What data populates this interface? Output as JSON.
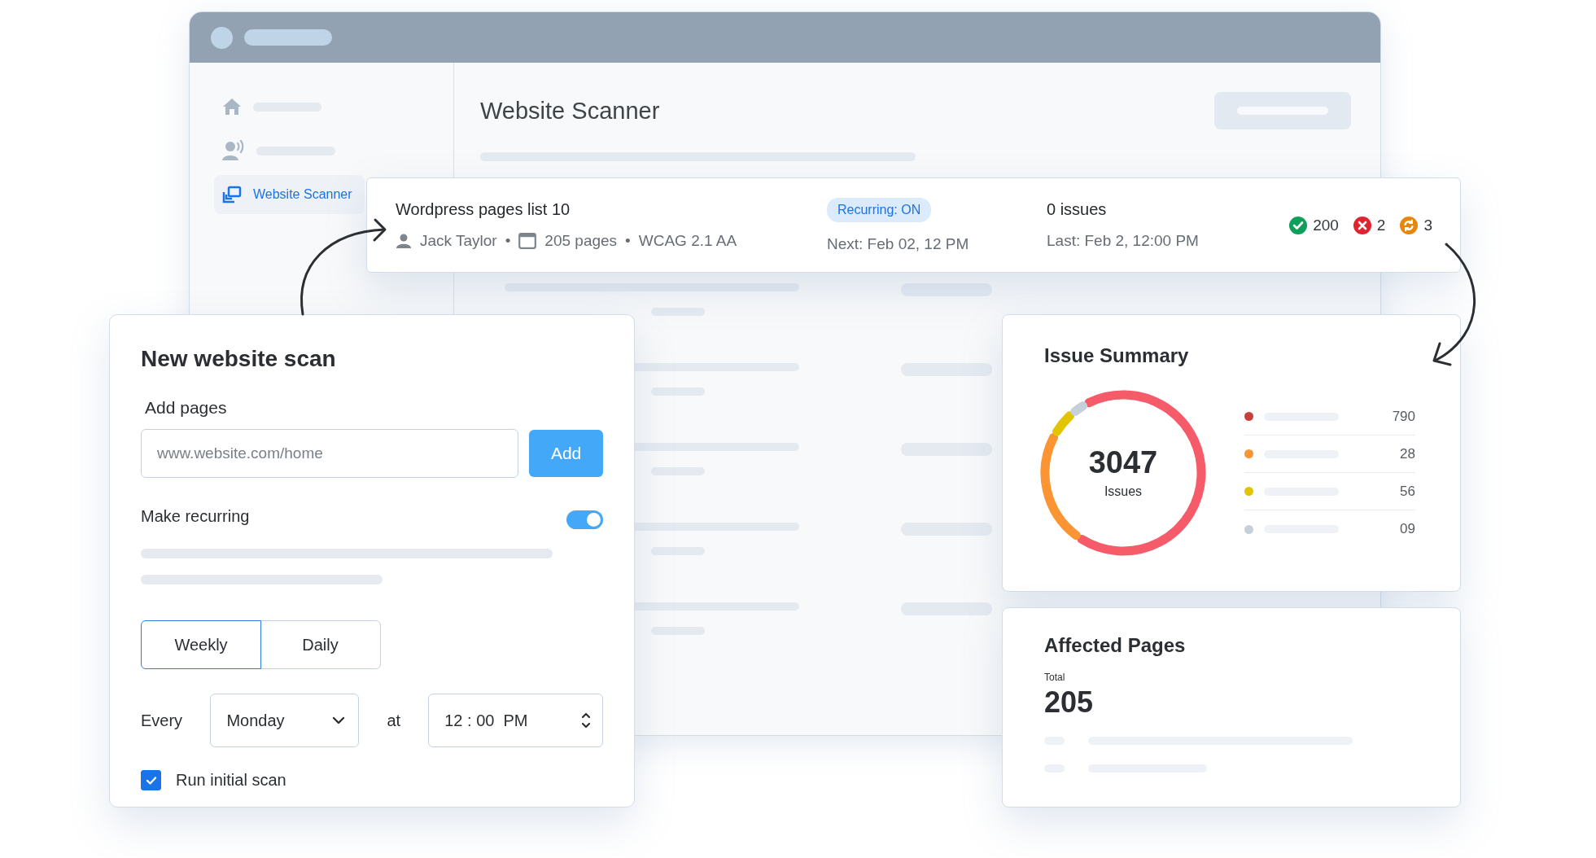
{
  "window": {
    "title": "Website Scanner",
    "sidebar": {
      "items": [
        {
          "selected": false
        },
        {
          "selected": false
        },
        {
          "label": "Website Scanner",
          "selected": true
        }
      ]
    }
  },
  "scan_card": {
    "title": "Wordpress pages list 10",
    "owner": "Jack Taylor",
    "separators": [
      "•",
      "•"
    ],
    "pages": "205 pages",
    "standard": "WCAG 2.1 AA",
    "badge": "Recurring: ON",
    "next": "Next: Feb 02, 12 PM",
    "issues": "0 issues",
    "last": "Last: Feb 2, 12:00 PM",
    "stats": [
      {
        "kind": "passed",
        "value": "200"
      },
      {
        "kind": "failed",
        "value": "2"
      },
      {
        "kind": "pending",
        "value": "3"
      }
    ]
  },
  "new_scan": {
    "title": "New website scan",
    "add_label": "Add pages",
    "url_placeholder": "www.website.com/home",
    "add_button": "Add",
    "recurring_label": "Make recurring",
    "recurring_on": true,
    "frequency_tabs": [
      {
        "label": "Weekly",
        "selected": true
      },
      {
        "label": "Daily",
        "selected": false
      }
    ],
    "every_label": "Every",
    "day": "Monday",
    "at_label": "at",
    "time": "12 : 00  PM",
    "initial_scan_label": "Run initial scan",
    "initial_scan_checked": true
  },
  "issue_summary": {
    "title": "Issue Summary",
    "total": "3047",
    "total_label": "Issues",
    "legend": [
      {
        "color": "#c8403c",
        "value": "790"
      },
      {
        "color": "#fb9433",
        "value": "28"
      },
      {
        "color": "#e2c400",
        "value": "56"
      },
      {
        "color": "#c5d0d9",
        "value": "09"
      }
    ]
  },
  "affected_pages": {
    "title": "Affected Pages",
    "total_label": "Total",
    "total": "205"
  }
}
